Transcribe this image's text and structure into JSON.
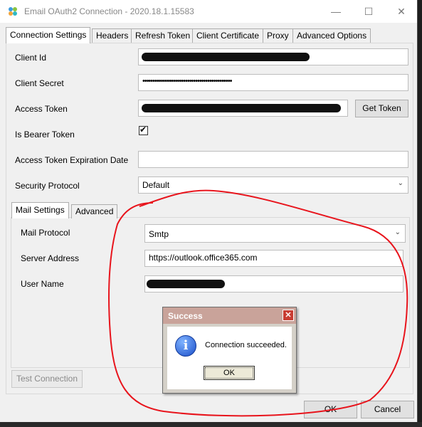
{
  "window": {
    "title": "Email OAuth2 Connection - 2020.18.1.15583",
    "minimize_glyph": "—",
    "maximize_glyph": "☐",
    "close_glyph": "✕"
  },
  "tabs": [
    "Connection Settings",
    "Headers",
    "Refresh Token",
    "Client Certificate",
    "Proxy",
    "Advanced Options"
  ],
  "form": {
    "client_id_label": "Client Id",
    "client_secret_label": "Client Secret",
    "client_secret_value": "••••••••••••••••••••••••••••••••••••••••••••",
    "access_token_label": "Access Token",
    "get_token_label": "Get Token",
    "bearer_label": "Is Bearer Token",
    "bearer_checked": "✔",
    "expiration_label": "Access Token Expiration Date",
    "expiration_value": "",
    "security_label": "Security Protocol",
    "security_value": "Default"
  },
  "subtabs": [
    "Mail Settings",
    "Advanced"
  ],
  "mail": {
    "protocol_label": "Mail Protocol",
    "protocol_value": "Smtp",
    "server_label": "Server Address",
    "server_value": "https://outlook.office365.com",
    "user_label": "User Name"
  },
  "buttons": {
    "test_connection": "Test Connection",
    "ok": "OK",
    "cancel": "Cancel"
  },
  "dialog": {
    "title": "Success",
    "message": "Connection succeeded.",
    "ok": "OK",
    "close_glyph": "✕",
    "info_glyph": "i"
  },
  "colors": {
    "annotation": "#e8141c",
    "dialog_title": "#c9a39a"
  }
}
